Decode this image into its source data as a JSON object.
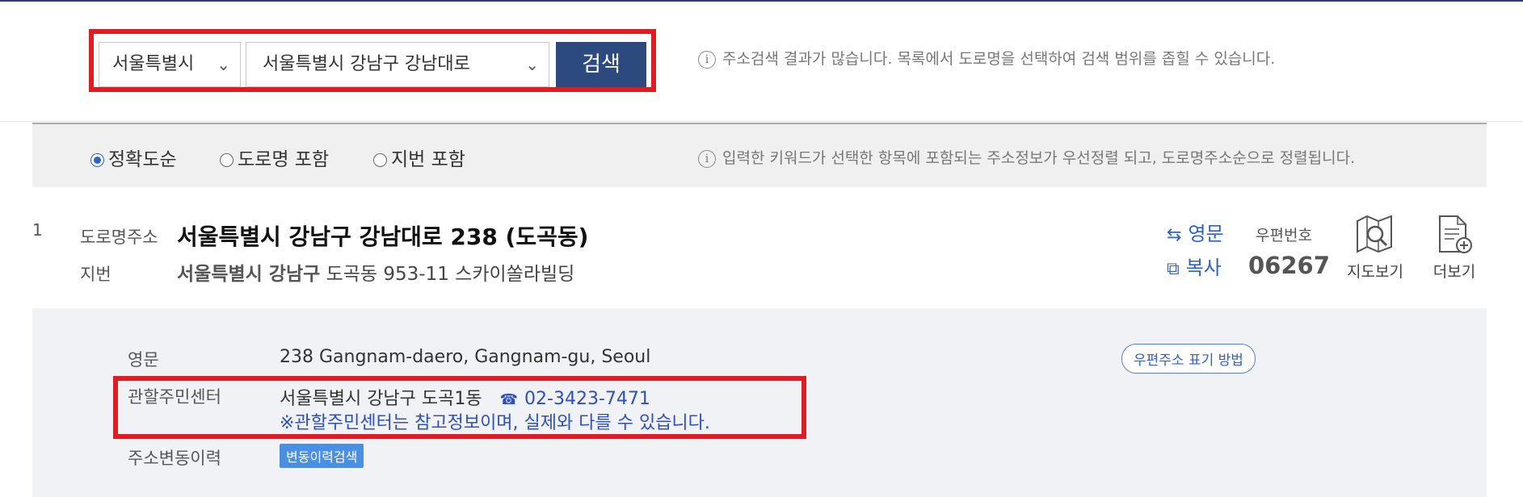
{
  "search": {
    "region": "서울특별시",
    "road": "서울특별시 강남구 강남대로",
    "button": "검색",
    "notice": "주소검색 결과가 많습니다. 목록에서 도로명을 선택하여 검색 범위를 좁힐 수 있습니다."
  },
  "filter": {
    "options": [
      "정확도순",
      "도로명 포함",
      "지번 포함"
    ],
    "selected": "정확도순",
    "notice": "입력한 키워드가 선택한 항목에 포함되는 주소정보가 우선정렬 되고, 도로명주소순으로 정렬됩니다."
  },
  "result": {
    "index": "1",
    "road_label": "도로명주소",
    "road_address": "서울특별시 강남구 강남대로 238 (도곡동)",
    "jibun_label": "지번",
    "jibun_bold": "서울특별시 강남구",
    "jibun_rest": "도곡동 953-11 스카이쏠라빌딩",
    "english_link": "영문",
    "copy_link": "복사",
    "zip_label": "우편번호",
    "zip_code": "06267",
    "map_label": "지도보기",
    "more_label": "더보기"
  },
  "detail": {
    "english_label": "영문",
    "english_value": "238 Gangnam-daero, Gangnam-gu, Seoul",
    "postal_button": "우편주소 표기 방법",
    "office_label": "관할주민센터",
    "office_value": "서울특별시 강남구 도곡1동",
    "office_phone": "02-3423-7471",
    "office_note": "※관할주민센터는 참고정보이며, 실제와 다를 수 있습니다.",
    "history_label": "주소변동이력",
    "history_button": "변동이력검색"
  },
  "colors": {
    "highlight_red": "#e01b22",
    "search_button": "#2d4a7e",
    "link_blue": "#2e62c7",
    "history_button": "#4a90e2"
  }
}
